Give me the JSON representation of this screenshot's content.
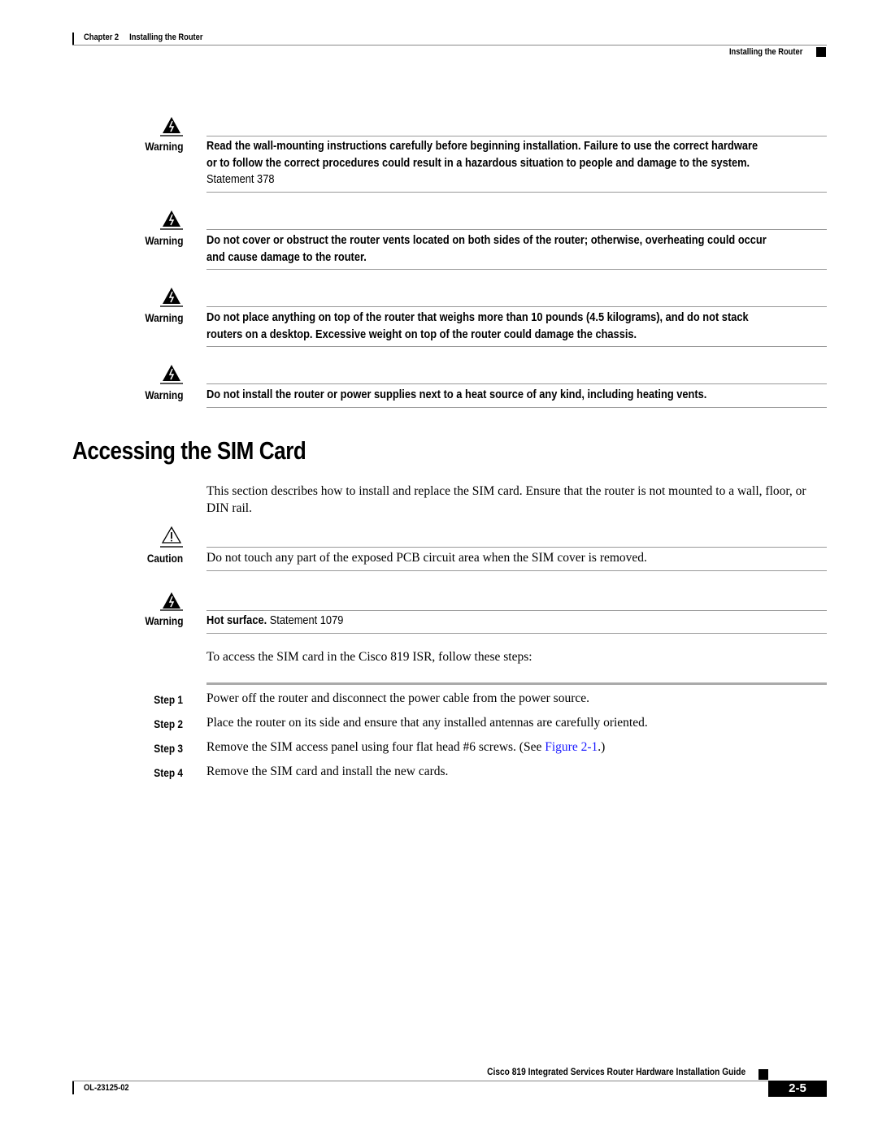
{
  "header": {
    "chapter": "Chapter 2",
    "chapter_title": "Installing the Router",
    "section": "Installing the Router"
  },
  "notes": [
    {
      "type": "Warning",
      "icon": "warning-shock-icon",
      "bold": "Read the wall-mounting instructions carefully before beginning installation. Failure to use the correct hardware or to follow the correct procedures could result in a hazardous situation to people and damage to the system.",
      "statement": "Statement 378"
    },
    {
      "type": "Warning",
      "icon": "warning-shock-icon",
      "bold": "Do not cover or obstruct the router vents located on both sides of the router; otherwise, overheating could occur and cause damage to the router.",
      "statement": ""
    },
    {
      "type": "Warning",
      "icon": "warning-shock-icon",
      "bold": "Do not place anything on top of the router that weighs more than 10 pounds (4.5 kilograms), and do not stack routers on a desktop. Excessive weight on top of the router could damage the chassis.",
      "statement": ""
    },
    {
      "type": "Warning",
      "icon": "warning-shock-icon",
      "bold": "Do not install the router or power supplies next to a heat source of any kind, including heating vents.",
      "statement": ""
    }
  ],
  "section": {
    "title": "Accessing the SIM Card",
    "intro": "This section describes how to install and replace the SIM card. Ensure that the router is not mounted to a wall, floor, or DIN rail.",
    "caution": {
      "type": "Caution",
      "icon": "caution-icon",
      "text": "Do not touch any part of the exposed PCB circuit area when the SIM cover is removed."
    },
    "warning": {
      "type": "Warning",
      "icon": "warning-shock-icon",
      "bold": "Hot surface.",
      "statement": "Statement 1079"
    },
    "steps_intro": "To access the SIM card in the Cisco 819 ISR, follow these steps:",
    "steps": [
      {
        "label": "Step 1",
        "text": "Power off the router and disconnect the power cable from the power source."
      },
      {
        "label": "Step 2",
        "text": "Place the router on its side and ensure that any installed antennas are carefully oriented."
      },
      {
        "label": "Step 3",
        "text_before": "Remove the SIM access panel using four flat head #6 screws. (See ",
        "link": "Figure 2-1",
        "text_after": ".)"
      },
      {
        "label": "Step 4",
        "text": "Remove the SIM card and install the new cards."
      }
    ]
  },
  "footer": {
    "guide_title": "Cisco 819 Integrated Services Router Hardware Installation Guide",
    "doc_number": "OL-23125-02",
    "page_number": "2-5"
  },
  "colors": {
    "link": "#1a1aff",
    "rule": "#999999"
  }
}
